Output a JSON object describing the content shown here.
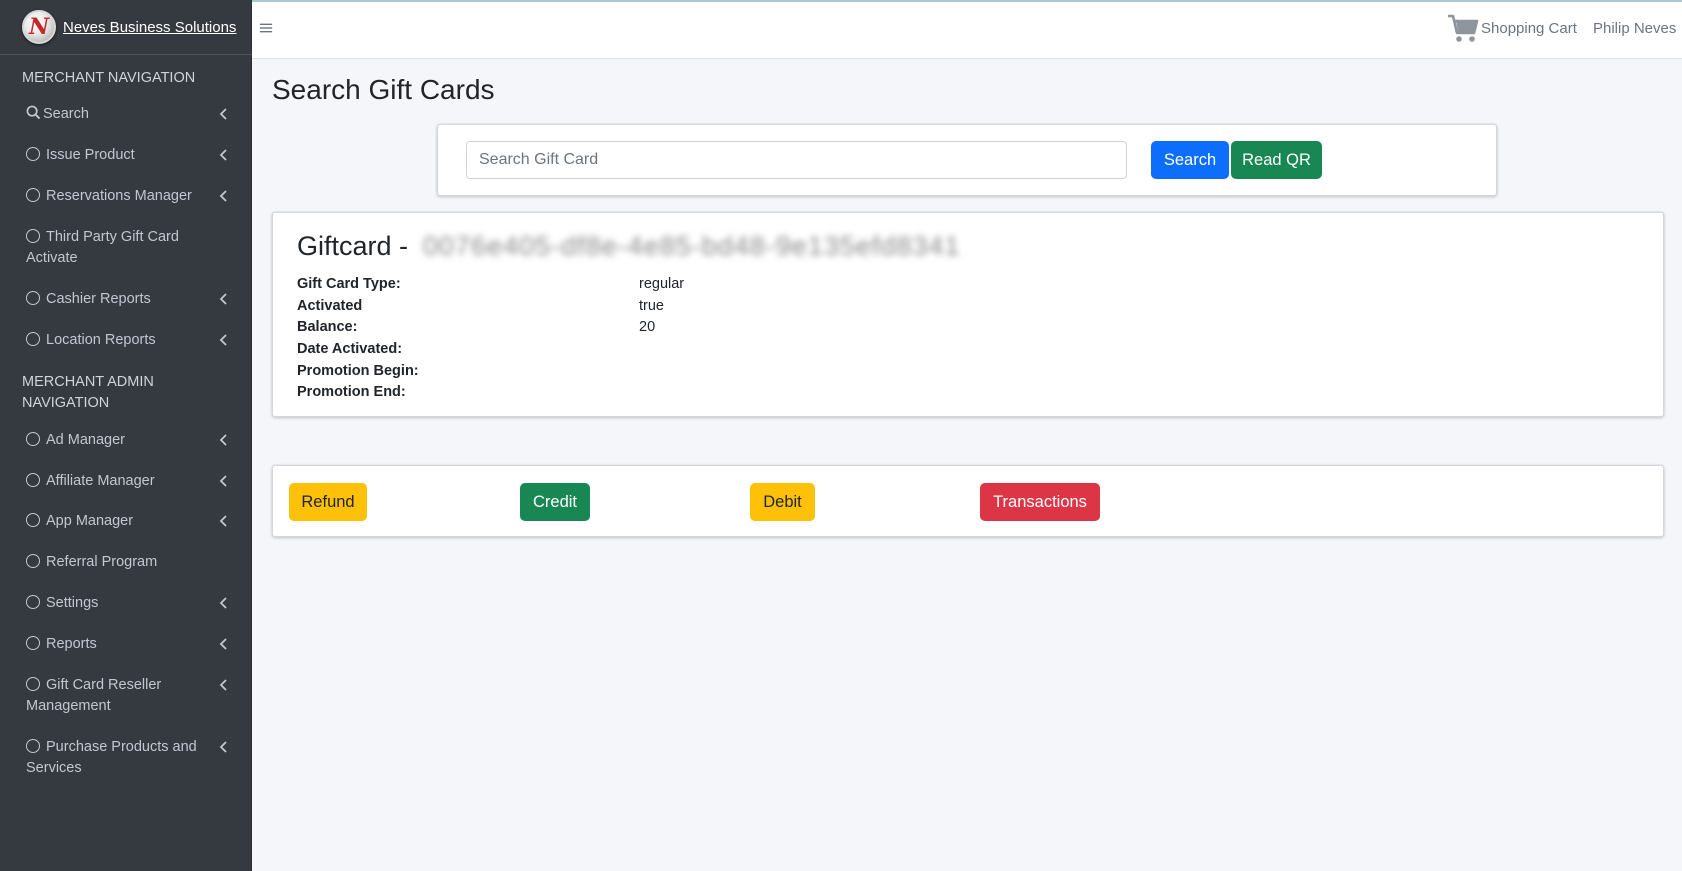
{
  "brand": {
    "name": "Neves Business Solutions",
    "logo_letter": "N"
  },
  "sidebar": {
    "header_merchant": "MERCHANT NAVIGATION",
    "header_admin": "MERCHANT ADMIN NAVIGATION",
    "merchant_items": [
      {
        "label": "Search",
        "icon": "search-icon",
        "has_submenu": true
      },
      {
        "label": "Issue Product",
        "icon": "circle-icon",
        "has_submenu": true
      },
      {
        "label": "Reservations Manager",
        "icon": "circle-icon",
        "has_submenu": true
      },
      {
        "label": "Third Party Gift Card Activate",
        "icon": "circle-icon",
        "has_submenu": false
      },
      {
        "label": "Cashier Reports",
        "icon": "circle-icon",
        "has_submenu": true
      },
      {
        "label": "Location Reports",
        "icon": "circle-icon",
        "has_submenu": true
      }
    ],
    "admin_items": [
      {
        "label": "Ad Manager",
        "icon": "circle-icon",
        "has_submenu": true
      },
      {
        "label": "Affiliate Manager",
        "icon": "circle-icon",
        "has_submenu": true
      },
      {
        "label": "App Manager",
        "icon": "circle-icon",
        "has_submenu": true
      },
      {
        "label": "Referral Program",
        "icon": "circle-icon",
        "has_submenu": false
      },
      {
        "label": "Settings",
        "icon": "circle-icon",
        "has_submenu": true
      },
      {
        "label": "Reports",
        "icon": "circle-icon",
        "has_submenu": true
      },
      {
        "label": "Gift Card Reseller Management",
        "icon": "circle-icon",
        "has_submenu": true
      },
      {
        "label": "Purchase Products and Services",
        "icon": "circle-icon",
        "has_submenu": true
      }
    ]
  },
  "topbar": {
    "menu_icon": "hamburger-icon",
    "cart_label": "Shopping Cart",
    "cart_icon": "shopping-cart-icon",
    "user_name": "Philip Neves"
  },
  "page": {
    "title": "Search Gift Cards"
  },
  "search": {
    "placeholder": "Search Gift Card",
    "value": "",
    "search_button": "Search",
    "qr_button": "Read QR"
  },
  "giftcard": {
    "title_prefix": "Giftcard - ",
    "id_redacted": "0076e405-df8e-4e85-bd48-9e135efd8341",
    "fields": [
      {
        "label": "Gift Card Type:",
        "value": "regular"
      },
      {
        "label": "Activated",
        "value": "true"
      },
      {
        "label": "Balance:",
        "value": "20"
      },
      {
        "label": "Date Activated:",
        "value": ""
      },
      {
        "label": "Promotion Begin:",
        "value": ""
      },
      {
        "label": "Promotion End:",
        "value": ""
      }
    ]
  },
  "actions": {
    "refund": "Refund",
    "credit": "Credit",
    "debit": "Debit",
    "transactions": "Transactions"
  },
  "colors": {
    "sidebar_bg": "#343a40",
    "primary": "#0d6efd",
    "success": "#198754",
    "warning": "#ffc107",
    "danger": "#dc3545"
  }
}
